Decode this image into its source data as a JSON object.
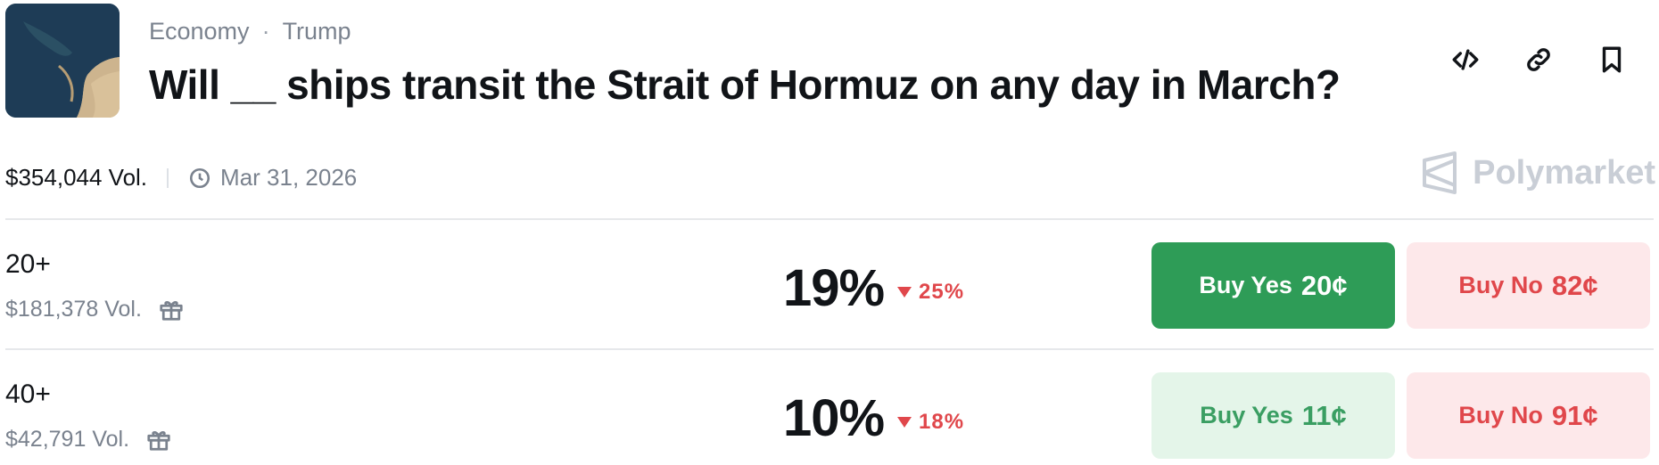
{
  "header": {
    "category": "Economy",
    "separator": "·",
    "tag": "Trump",
    "title": "Will __ ships transit the Strait of Hormuz on any day in March?"
  },
  "actions": [
    {
      "icon": "embed-code-icon"
    },
    {
      "icon": "link-icon"
    },
    {
      "icon": "bookmark-icon"
    }
  ],
  "meta": {
    "volume": "$354,044 Vol.",
    "end_date": "Mar 31, 2026"
  },
  "brand": {
    "name": "Polymarket"
  },
  "outcomes": [
    {
      "label": "20+",
      "volume": "$181,378 Vol.",
      "probability": "19%",
      "change": "25%",
      "change_direction": "down",
      "yes_label": "Buy Yes",
      "yes_price": "20¢",
      "no_label": "Buy No",
      "no_price": "82¢",
      "yes_style": "solid"
    },
    {
      "label": "40+",
      "volume": "$42,791 Vol.",
      "probability": "10%",
      "change": "18%",
      "change_direction": "down",
      "yes_label": "Buy Yes",
      "yes_price": "11¢",
      "no_label": "Buy No",
      "no_price": "91¢",
      "yes_style": "soft"
    }
  ],
  "colors": {
    "yes_green": "#2e9c57",
    "yes_soft_bg": "#e4f5e9",
    "no_red": "#e0474b",
    "no_soft_bg": "#fde8ea",
    "muted_text": "#7a828e"
  }
}
